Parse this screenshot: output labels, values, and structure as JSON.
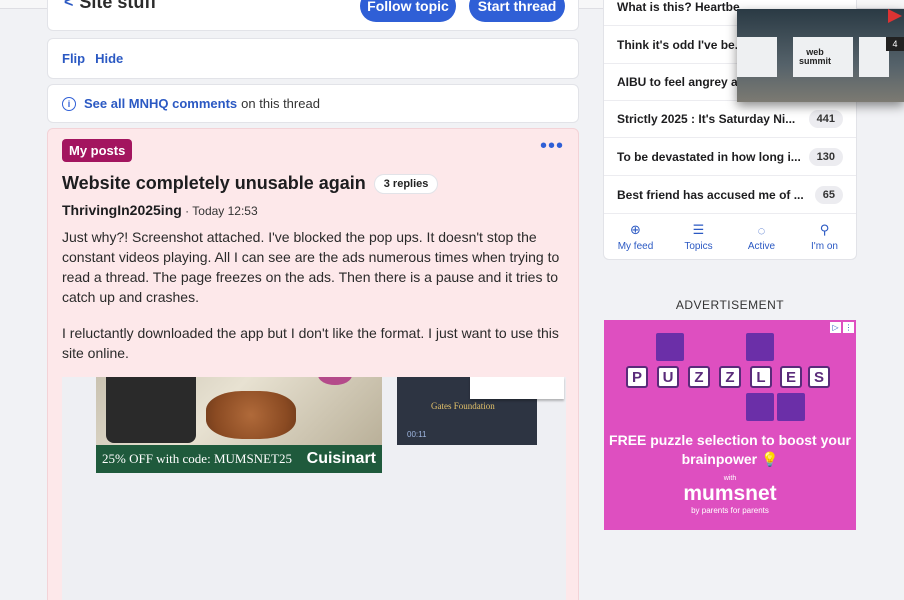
{
  "topic": {
    "back_label": "Site stuff",
    "follow_label": "Follow topic",
    "start_label": "Start thread"
  },
  "actions": {
    "flip": "Flip",
    "hide": "Hide"
  },
  "mnhq": {
    "link": "See all MNHQ comments",
    "suffix": "on this thread"
  },
  "post": {
    "badge": "My posts",
    "title": "Website completely unusable again",
    "replies": "3 replies",
    "author": "ThrivingIn2025ing",
    "separator": " · ",
    "time": "Today 12:53",
    "paragraph1": "Just why?! Screenshot attached. I've blocked the pop ups. It doesn't stop the constant videos playing. All I can see are the ads numerous times when trying to read a thread. The page freezes on the ads. Then there is a pause and it tries to catch up and crashes.",
    "paragraph2": "I reluctantly downloaded the app but I don't like the format. I just want to use this site online."
  },
  "attachment": {
    "promo_code": "25% OFF with code: MUMSNET25",
    "brand": "Cuisinart",
    "video_text": "Gates Foundation",
    "video_ctl": "00:11"
  },
  "sidebar": {
    "threads": [
      {
        "title": "What is this? Heartbe...",
        "count": ""
      },
      {
        "title": "Think it's odd I've be...",
        "count": ""
      },
      {
        "title": "AIBU to feel angrey a...",
        "count": ""
      },
      {
        "title": "Strictly 2025 : It's Saturday Ni...",
        "count": "441"
      },
      {
        "title": "To be devastated in how long i...",
        "count": "130"
      },
      {
        "title": "Best friend has accused me of ...",
        "count": "65"
      }
    ],
    "nav": [
      {
        "label": "My feed",
        "icon": "plus-circle-icon"
      },
      {
        "label": "Topics",
        "icon": "list-icon"
      },
      {
        "label": "Active",
        "icon": "chat-icon"
      },
      {
        "label": "I'm on",
        "icon": "pin-icon"
      }
    ]
  },
  "advert": {
    "label": "ADVERTISEMENT",
    "letters": [
      "P",
      "U",
      "Z",
      "Z",
      "L",
      "E",
      "S"
    ],
    "text": "FREE puzzle selection to boost your brainpower 💡",
    "with": "with",
    "logo": "mumsnet",
    "tagline": "by parents for parents"
  },
  "pip": {
    "sign1": "web",
    "sign2": "summit",
    "badge": "4"
  }
}
